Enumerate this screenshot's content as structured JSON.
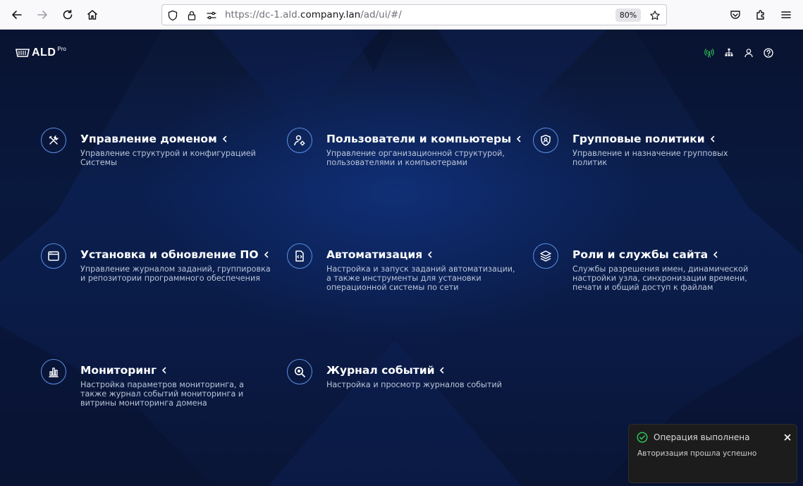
{
  "browser": {
    "url_prefix": "https://dc-1.ald.",
    "url_host": "company.lan",
    "url_suffix": "/ad/ui/#/",
    "zoom": "80%"
  },
  "app": {
    "logo_text": "ALD",
    "logo_sup": "Pro"
  },
  "tiles": [
    {
      "title": "Управление доменом",
      "desc": "Управление структурой и конфигурацией Системы"
    },
    {
      "title": "Пользователи и компьютеры",
      "desc": "Управление организационной структурой, пользователями и компьютерами"
    },
    {
      "title": "Групповые политики",
      "desc": "Управление и назначение групповых политик"
    },
    {
      "title": "Установка и обновление ПО",
      "desc": "Управление журналом заданий, группировка и репозитории программного обеспечения"
    },
    {
      "title": "Автоматизация",
      "desc": "Настройка и запуск заданий автоматизации, а также инструменты для установки операционной системы по сети"
    },
    {
      "title": "Роли и службы сайта",
      "desc": "Службы разрешения имен, динамической настройки узла, синхронизации времени, печати и общий доступ к файлам"
    },
    {
      "title": "Мониторинг",
      "desc": "Настройка параметров мониторинга, а также журнал событий мониторинга и витрины мониторинга домена"
    },
    {
      "title": "Журнал событий",
      "desc": "Настройка и просмотр журналов событий"
    }
  ],
  "toast": {
    "title": "Операция выполнена",
    "message": "Авторизация прошла успешно"
  },
  "colors": {
    "accent_icon_border": "#5d8fe6",
    "status_green": "#2fbf5a",
    "toast_bg": "#1c1c1c"
  }
}
